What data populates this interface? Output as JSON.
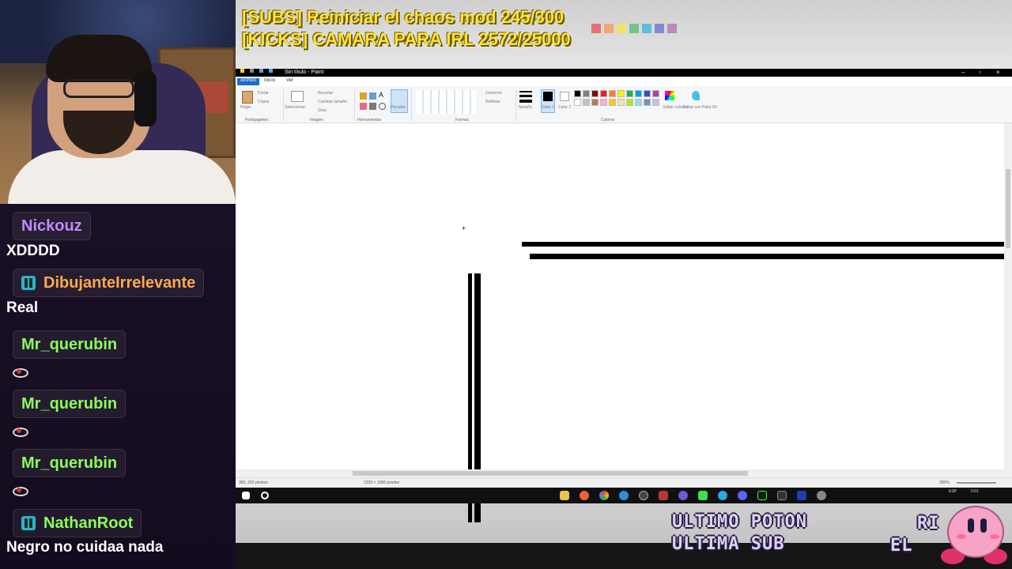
{
  "overlay": {
    "subs_line": "[SUBS] Reiniciar el chaos mod 245/300",
    "kicks_line": "[KICKS] CAMARA PARA IRL 2572/25000"
  },
  "chat": {
    "messages": [
      {
        "user": "Nickouz",
        "user_color": "#c08aff",
        "badge": false,
        "text": "XDDDD",
        "emote": false
      },
      {
        "user": "DibujanteIrrelevante",
        "user_color": "#ffa94d",
        "badge": true,
        "text": "Real",
        "emote": false
      },
      {
        "user": "Mr_querubin",
        "user_color": "#8aff5a",
        "badge": false,
        "text": "",
        "emote": true
      },
      {
        "user": "Mr_querubin",
        "user_color": "#8aff5a",
        "badge": false,
        "text": "",
        "emote": true
      },
      {
        "user": "Mr_querubin",
        "user_color": "#8aff5a",
        "badge": false,
        "text": "",
        "emote": true
      },
      {
        "user": "NathanRoot",
        "user_color": "#8aff5a",
        "badge": true,
        "text": "Negro no cuidaa nada",
        "emote": false
      }
    ]
  },
  "paint": {
    "window_title": "Sin título - Paint",
    "tabs": [
      "Archivo",
      "Inicio",
      "Ver"
    ],
    "ribbon": {
      "clipboard": {
        "paste": "Pegar",
        "cut": "Cortar",
        "copy": "Copiar",
        "group": "Portapapeles"
      },
      "image": {
        "select": "Seleccionar",
        "crop": "Recortar",
        "resize": "Cambiar tamaño",
        "rotate": "Girar",
        "group": "Imagen"
      },
      "tools": {
        "brushes": "Pinceles",
        "group": "Herramientas"
      },
      "shapes": {
        "outline": "Contorno",
        "fill": "Rellenar",
        "group": "Formas"
      },
      "size": "Tamaño",
      "color1": "Color 1",
      "color2": "Color 2",
      "edit_colors": "Editar colores",
      "paint3d": "Editar con Paint 3D",
      "colors_group": "Colores"
    },
    "palette": [
      "#000000",
      "#7f7f7f",
      "#880015",
      "#ed1c24",
      "#ff7f27",
      "#fff200",
      "#22b14c",
      "#00a2e8",
      "#3f48cc",
      "#a349a4",
      "#ffffff",
      "#c3c3c3",
      "#b97a57",
      "#ffaec9",
      "#ffc90e",
      "#efe4b0",
      "#b5e61d",
      "#99d9ea",
      "#7092be",
      "#c8bfe7"
    ],
    "status": {
      "cursor_pos": "360, 202 píxeles",
      "canvas_size": "1200 × 1068 píxeles",
      "zoom": "300%"
    }
  },
  "taskbar": {
    "lang": "ESP",
    "time": "0:01"
  },
  "bottom_overlay": {
    "line1": "ULTIMO POTON",
    "line2": "ULTIMA SUB",
    "right1": "RI",
    "right2": "EL"
  }
}
